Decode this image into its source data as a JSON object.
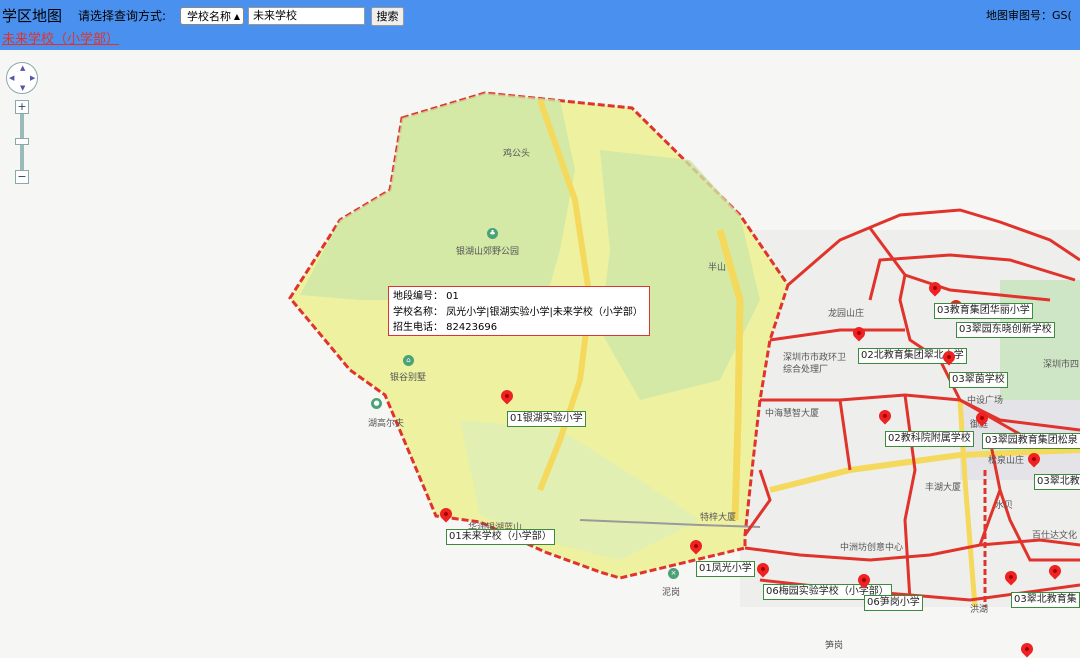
{
  "header": {
    "title": "学区地图",
    "query_label": "请选择查询方式:",
    "query_type": "学校名称",
    "search_value": "未来学校",
    "search_button": "搜索",
    "map_approval": "地图审图号：GS("
  },
  "result_link": "未来学校（小学部）",
  "info_popup": {
    "district_line": "地段编号： 01",
    "school_line": "学校名称： 凤光小学|银湖实验小学|未来学校（小学部）",
    "phone_line": "招生电话： 82423696"
  },
  "schools": [
    {
      "label": "01银湖实验小学"
    },
    {
      "label": "01未来学校（小学部）"
    },
    {
      "label": "01凤光小学"
    },
    {
      "label": "03教育集团华丽小学"
    },
    {
      "label": "03翠园东晓创新学校"
    },
    {
      "label": "02北教育集团翠北小学"
    },
    {
      "label": "03翠茵学校"
    },
    {
      "label": "02教科院附属学校"
    },
    {
      "label": "03翠园教育集团松泉"
    },
    {
      "label": "03翠北教"
    },
    {
      "label": "06梅园实验学校（小学部）"
    },
    {
      "label": "06笋岗小学"
    },
    {
      "label": "03翠北教育集"
    }
  ],
  "places": {
    "jigongtou": "鸡公头",
    "yinhu_park": "银湖山郊野公园",
    "banshan": "半山",
    "yingu": "银谷别墅",
    "golf": "湖高尔夫",
    "longyuan": "龙园山庄",
    "municipal": "深圳市市政环卫",
    "municipal2": "综合处理厂",
    "zhonghai": "中海慧智大厦",
    "shenzhen_right": "深圳市四",
    "zhongshe": "中设广场",
    "yuting": "御庭",
    "songquan": "松泉山庄",
    "fenghu": "丰湖大厦",
    "shuibei": "水贝",
    "baishida": "百仕达文化",
    "zhongzhou": "中洲坊创意中心",
    "tewei": "特梓大厦",
    "nigang": "泥岗",
    "honglin": "洪湖",
    "sungang": "笋岗",
    "yinhu_mid": "华润银湖蓝山"
  }
}
